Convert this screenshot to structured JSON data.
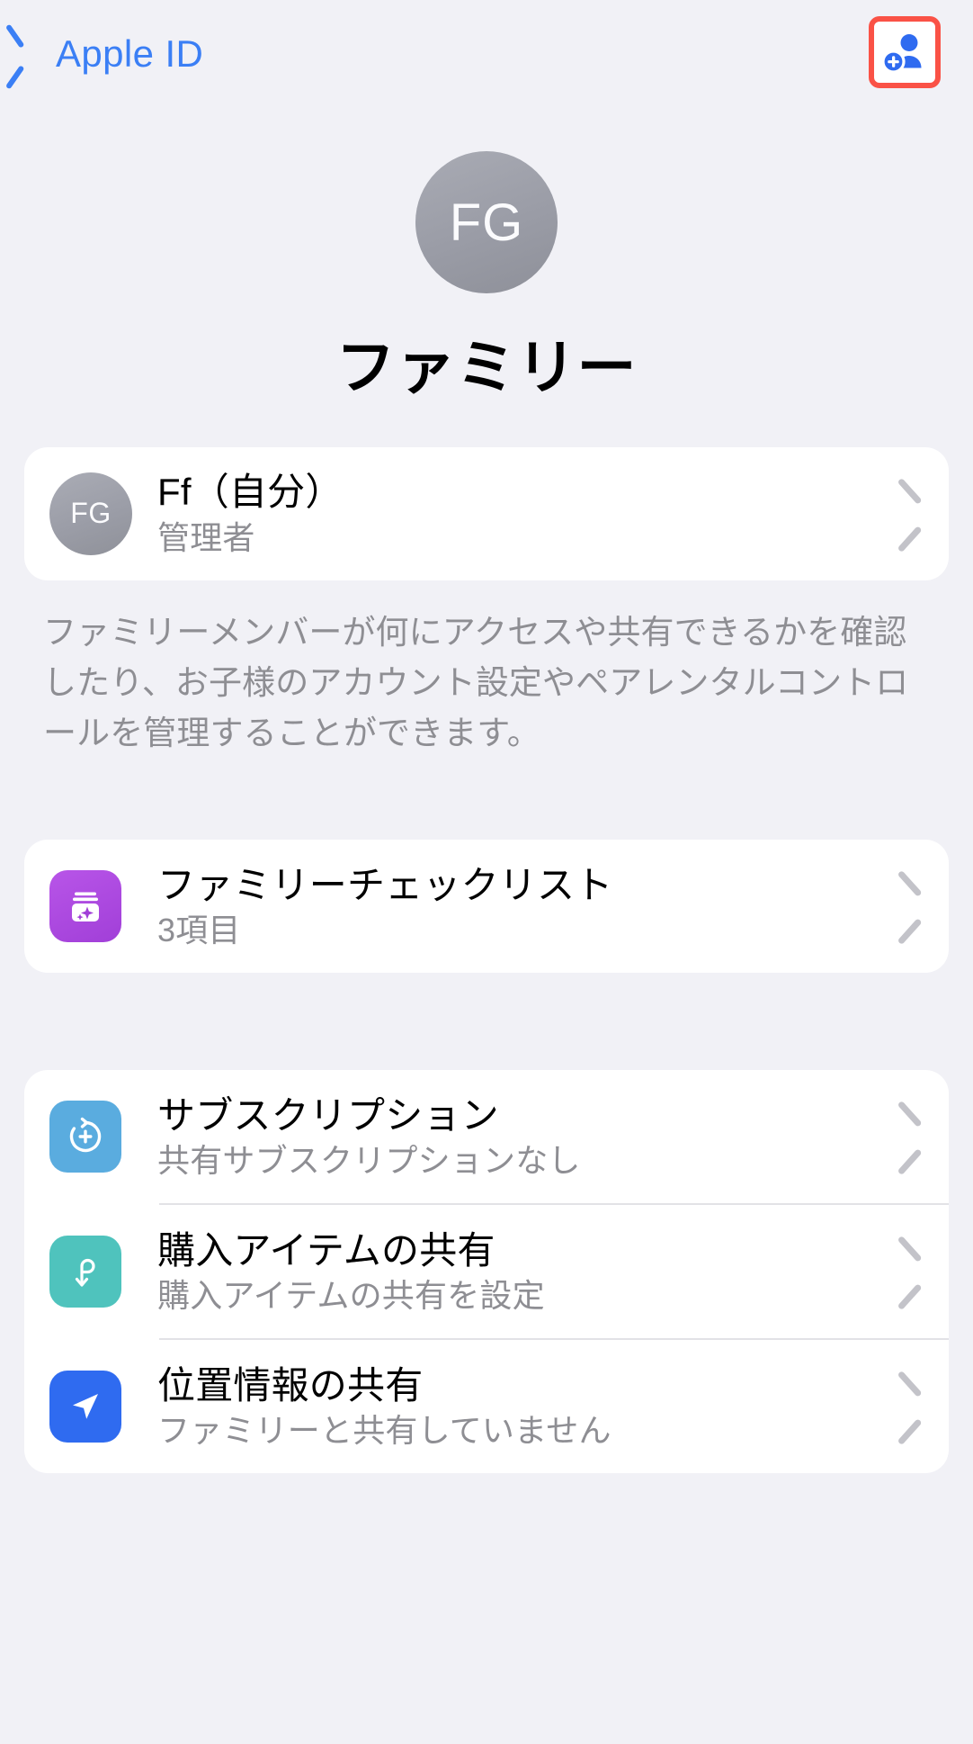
{
  "navbar": {
    "back_label": "Apple ID",
    "back_icon": "chevron-left-icon",
    "add_member_icon": "person-badge-plus-icon",
    "highlight_color": "#fa5246",
    "tint_color": "#3b7ff5"
  },
  "header": {
    "avatar_initials": "FG",
    "title": "ファミリー"
  },
  "member_card": {
    "rows": [
      {
        "avatar_initials": "FG",
        "title": "Ff（自分）",
        "subtitle": "管理者",
        "chevron": "chevron-right-icon"
      }
    ]
  },
  "member_note": "ファミリーメンバーが何にアクセスや共有できるかを確認したり、お子様のアカウント設定やペアレンタルコントロールを管理することができます。",
  "checklist_card": {
    "rows": [
      {
        "icon": "family-checklist-jar-icon",
        "icon_color": "#a13fd8",
        "title": "ファミリーチェックリスト",
        "subtitle": "3項目",
        "chevron": "chevron-right-icon"
      }
    ]
  },
  "sharing_card": {
    "rows": [
      {
        "icon": "subscriptions-icon",
        "icon_color": "#5aacdf",
        "title": "サブスクリプション",
        "subtitle": "共有サブスクリプションなし",
        "chevron": "chevron-right-icon"
      },
      {
        "icon": "purchase-sharing-icon",
        "icon_color": "#4fc3bd",
        "title": "購入アイテムの共有",
        "subtitle": "購入アイテムの共有を設定",
        "chevron": "chevron-right-icon"
      },
      {
        "icon": "location-sharing-icon",
        "icon_color": "#2f6bf0",
        "title": "位置情報の共有",
        "subtitle": "ファミリーと共有していません",
        "chevron": "chevron-right-icon"
      }
    ]
  }
}
